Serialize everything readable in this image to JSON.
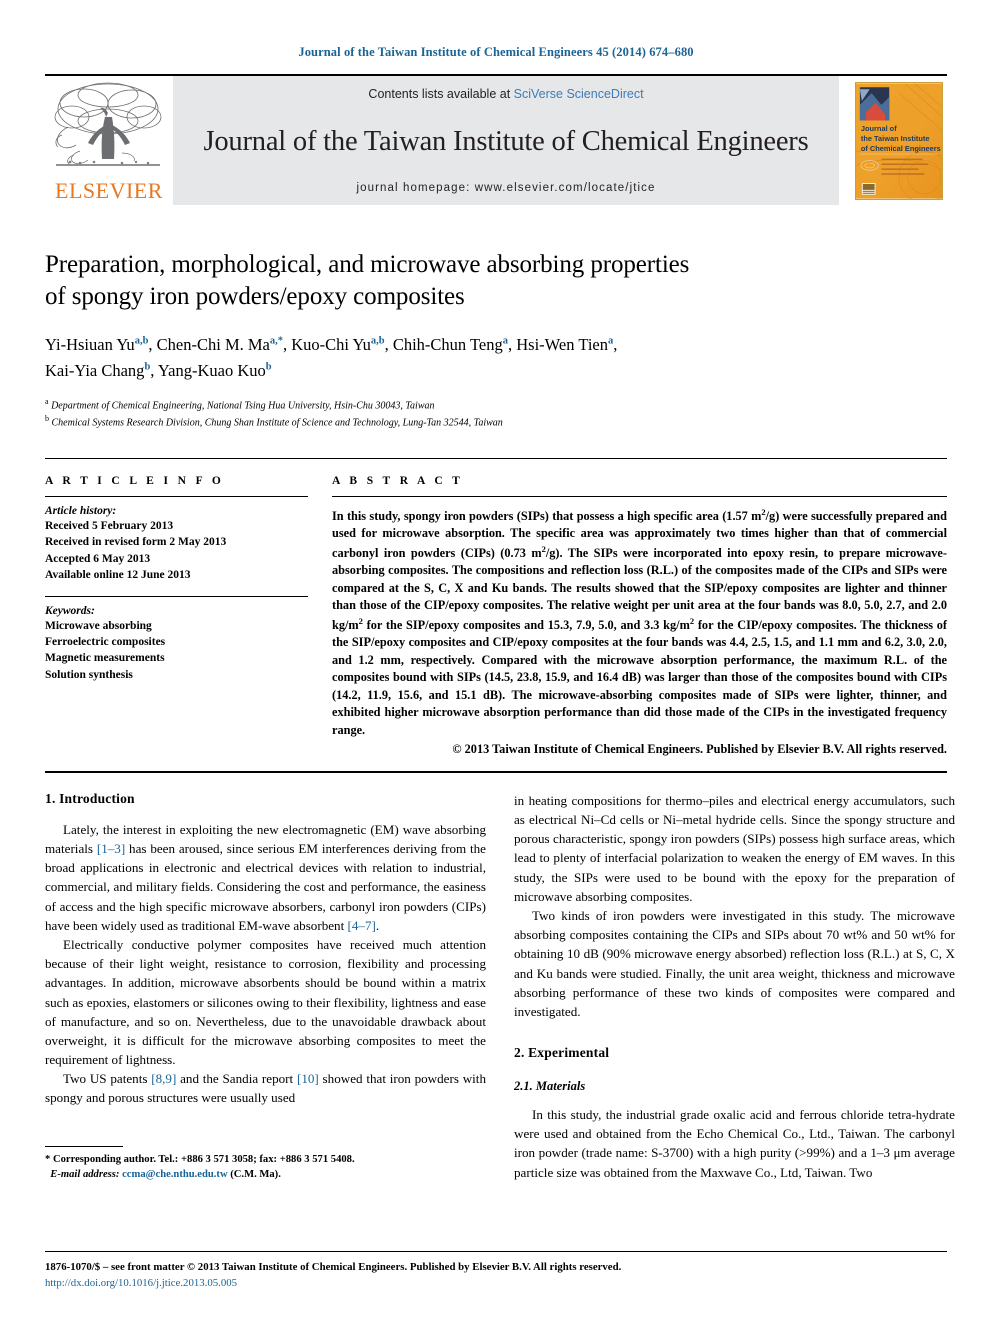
{
  "running_head": "Journal of the Taiwan Institute of Chemical Engineers 45 (2014) 674–680",
  "masthead": {
    "publisher_name": "ELSEVIER",
    "contents_prefix": "Contents lists available at ",
    "contents_link": "SciVerse ScienceDirect",
    "journal_title": "Journal of the Taiwan Institute of Chemical Engineers",
    "homepage": "journal homepage: www.elsevier.com/locate/jtice",
    "cover_title_line1": "Journal of",
    "cover_title_line2": "the Taiwan Institute",
    "cover_title_line3": "of Chemical Engineers"
  },
  "article": {
    "title_line1": "Preparation, morphological, and microwave absorbing properties",
    "title_line2": "of spongy iron powders/epoxy composites",
    "authors_line1": "Yi-Hsiuan Yu a,b, Chen-Chi M. Ma a,*, Kuo-Chi Yu a,b, Chih-Chun Teng a, Hsi-Wen Tien a,",
    "authors_line2": "Kai-Yia Chang b, Yang-Kuao Kuo b",
    "affiliation_a": "Department of Chemical Engineering, National Tsing Hua University, Hsin-Chu 30043, Taiwan",
    "affiliation_b": "Chemical Systems Research Division, Chung Shan Institute of Science and Technology, Lung-Tan 32544, Taiwan"
  },
  "article_info": {
    "section_label": "A R T I C L E   I N F O",
    "history_label": "Article history:",
    "history": [
      "Received 5 February 2013",
      "Received in revised form 2 May 2013",
      "Accepted 6 May 2013",
      "Available online 12 June 2013"
    ],
    "keywords_label": "Keywords:",
    "keywords": [
      "Microwave absorbing",
      "Ferroelectric composites",
      "Magnetic measurements",
      "Solution synthesis"
    ]
  },
  "abstract": {
    "section_label": "A B S T R A C T",
    "paragraph": "In this study, spongy iron powders (SIPs) that possess a high specific area (1.57 m2/g) were successfully prepared and used for microwave absorption. The specific area was approximately two times higher than that of commercial carbonyl iron powders (CIPs) (0.73 m2/g). The SIPs were incorporated into epoxy resin, to prepare microwave-absorbing composites. The compositions and reflection loss (R.L.) of the composites made of the CIPs and SIPs were compared at the S, C, X and Ku bands. The results showed that the SIP/epoxy composites are lighter and thinner than those of the CIP/epoxy composites. The relative weight per unit area at the four bands was 8.0, 5.0, 2.7, and 2.0 kg/m2 for the SIP/epoxy composites and 15.3, 7.9, 5.0, and 3.3 kg/m2 for the CIP/epoxy composites. The thickness of the SIP/epoxy composites and CIP/epoxy composites at the four bands was 4.4, 2.5, 1.5, and 1.1 mm and 6.2, 3.0, 2.0, and 1.2 mm, respectively. Compared with the microwave absorption performance, the maximum R.L. of the composites bound with SIPs (14.5, 23.8, 15.9, and 16.4 dB) was larger than those of the composites bound with CIPs (14.2, 11.9, 15.6, and 15.1 dB). The microwave-absorbing composites made of SIPs were lighter, thinner, and exhibited higher microwave absorption performance than did those made of the CIPs in the investigated frequency range.",
    "copyright": "© 2013 Taiwan Institute of Chemical Engineers. Published by Elsevier B.V. All rights reserved."
  },
  "body": {
    "heading_intro": "1.  Introduction",
    "heading_experimental": "2.  Experimental",
    "heading_materials": "2.1.  Materials",
    "left_p1_a": "Lately, the interest in exploiting the new electromagnetic (EM) wave absorbing materials ",
    "left_p1_ref1": "[1–3]",
    "left_p1_b": " has been aroused, since serious EM interferences deriving from the broad applications in electronic and electrical devices with relation to industrial, commercial, and military fields. Considering the cost and performance, the easiness of access and the high specific microwave absorbers, carbonyl iron powders (CIPs) have been widely used as traditional EM-wave absorbent ",
    "left_p1_ref2": "[4–7]",
    "left_p1_c": ".",
    "left_p2": "Electrically conductive polymer composites have received much attention because of their light weight, resistance to corrosion, flexibility and processing advantages. In addition, microwave absorbents should be bound within a matrix such as epoxies, elastomers or silicones owing to their flexibility, lightness and ease of manufacture, and so on. Nevertheless, due to the unavoidable drawback about overweight, it is difficult for the microwave absorbing composites to meet the requirement of lightness.",
    "left_p3_a": "Two US patents ",
    "left_p3_ref1": "[8,9]",
    "left_p3_b": " and the Sandia report ",
    "left_p3_ref2": "[10]",
    "left_p3_c": " showed that iron powders with spongy and porous structures were usually used",
    "right_p1": "in heating compositions for thermo–piles and electrical energy accumulators, such as electrical Ni–Cd cells or Ni–metal hydride cells. Since the spongy structure and porous characteristic, spongy iron powders (SIPs) possess high surface areas, which lead to plenty of interfacial polarization to weaken the energy of EM waves. In this study, the SIPs were used to be bound with the epoxy for the preparation of microwave absorbing composites.",
    "right_p2": "Two kinds of iron powders were investigated in this study. The microwave absorbing composites containing the CIPs and SIPs about 70 wt% and 50 wt% for obtaining 10 dB (90% microwave energy absorbed) reflection loss (R.L.) at S, C, X and Ku bands were studied. Finally, the unit area weight, thickness and microwave absorbing performance of these two kinds of composites were compared and investigated.",
    "right_p3": "In this study, the industrial grade oxalic acid and ferrous chloride tetra-hydrate were used and obtained from the Echo Chemical Co., Ltd., Taiwan. The carbonyl iron powder (trade name: S-3700) with a high purity (>99%) and a 1–3 μm average particle size was obtained from the Maxwave Co., Ltd, Taiwan. Two"
  },
  "footnote": {
    "marker": "*",
    "corresponding": " Corresponding author. Tel.: +886 3 571 3058; fax: +886 3 571 5408.",
    "email_label": "E-mail address:",
    "email": "ccma@che.nthu.edu.tw",
    "email_suffix": " (C.M. Ma)."
  },
  "footer": {
    "copyright": "1876-1070/$ – see front matter © 2013 Taiwan Institute of Chemical Engineers. Published by Elsevier B.V. All rights reserved.",
    "doi": "http://dx.doi.org/10.1016/j.jtice.2013.05.005"
  },
  "colors": {
    "link_blue": "#1a6496",
    "sciencedirect_blue": "#3b7cb8",
    "elsevier_orange": "#e87722",
    "masthead_gray": "#e6e7e8"
  }
}
